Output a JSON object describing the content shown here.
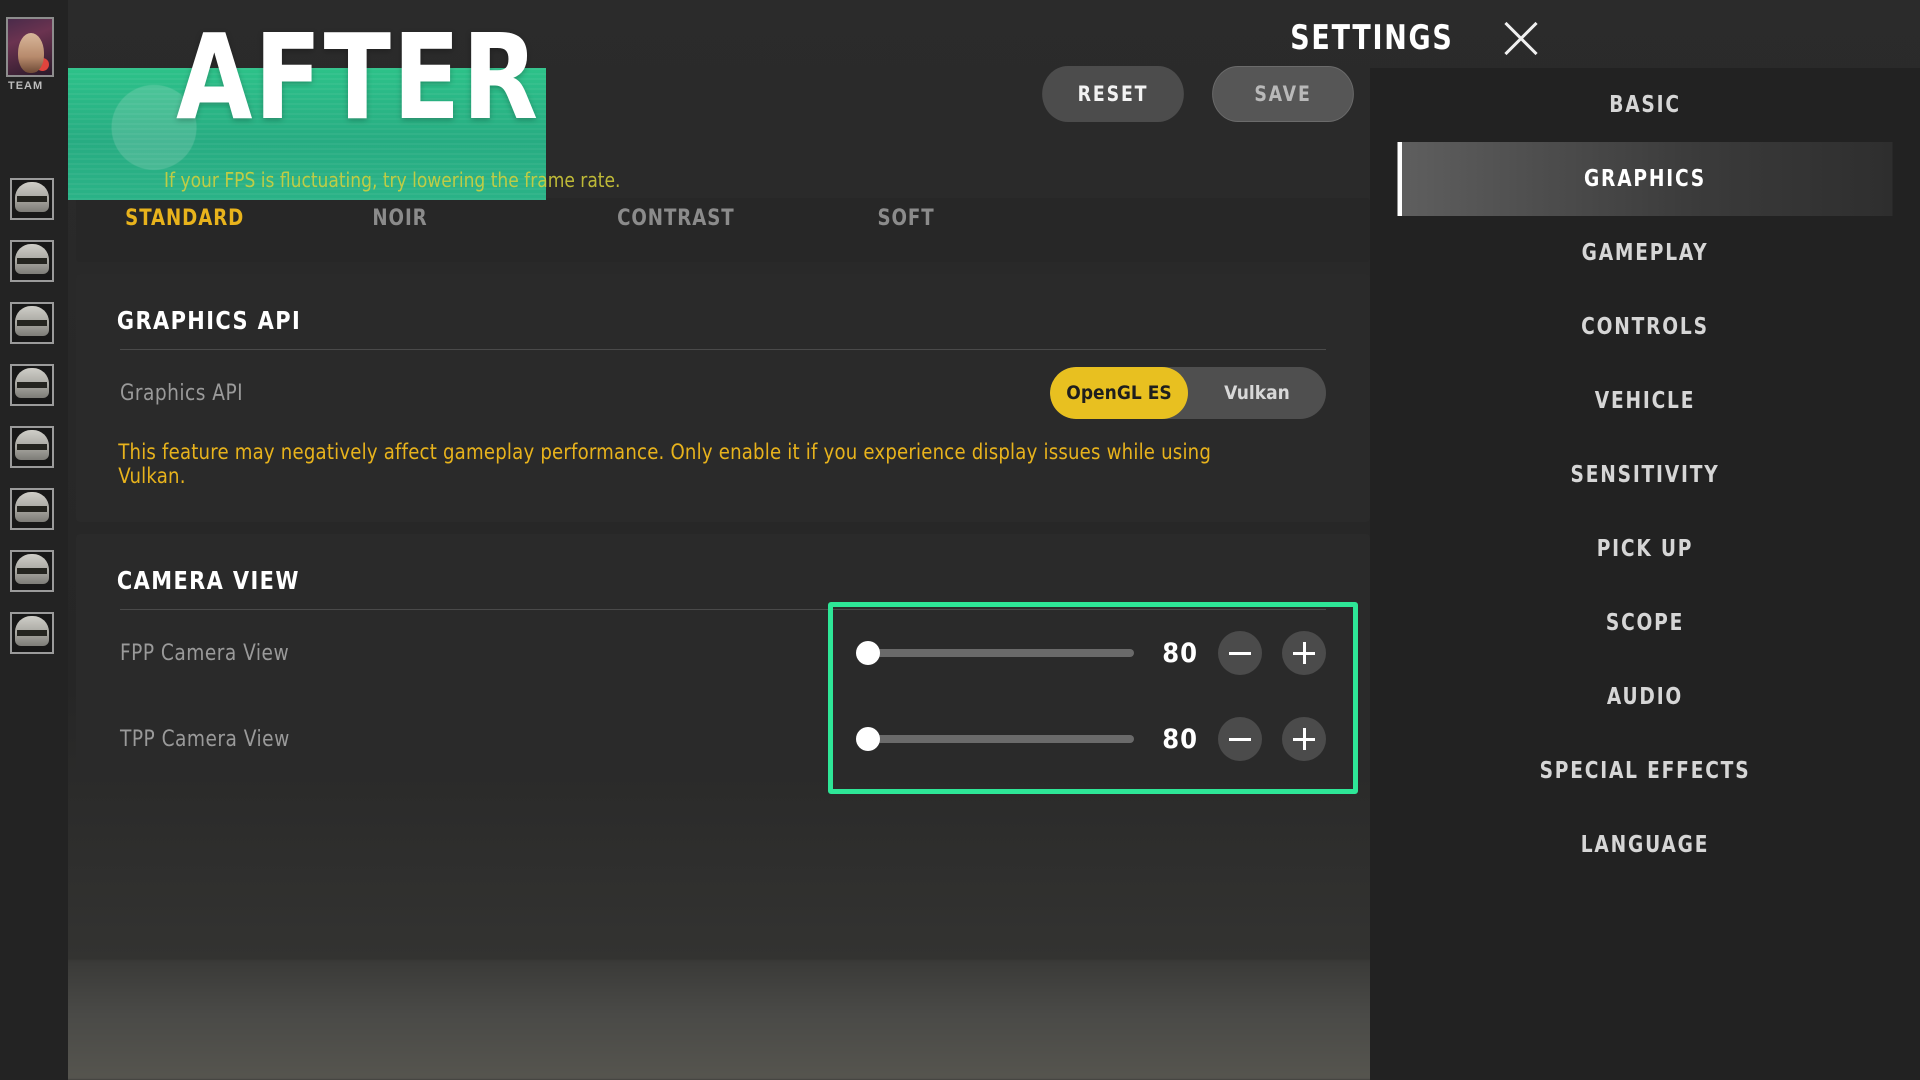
{
  "header": {
    "title": "SETTINGS",
    "close_icon": "close-icon",
    "reset_label": "RESET",
    "save_label": "SAVE"
  },
  "left_rail": {
    "team_label": "TEAM",
    "teammate_count": 8
  },
  "nav": {
    "items": [
      {
        "label": "BASIC",
        "active": false
      },
      {
        "label": "GRAPHICS",
        "active": true
      },
      {
        "label": "GAMEPLAY",
        "active": false
      },
      {
        "label": "CONTROLS",
        "active": false
      },
      {
        "label": "VEHICLE",
        "active": false
      },
      {
        "label": "SENSITIVITY",
        "active": false
      },
      {
        "label": "PICK UP",
        "active": false
      },
      {
        "label": "SCOPE",
        "active": false
      },
      {
        "label": "AUDIO",
        "active": false
      },
      {
        "label": "SPECIAL EFFECTS",
        "active": false
      },
      {
        "label": "LANGUAGE",
        "active": false
      }
    ]
  },
  "overlay": {
    "banner_text": "AFTER",
    "fps_tip": "If your FPS is fluctuating, try lowering the frame rate.",
    "highlight_color": "#2ee697",
    "banner_color": "#2ecf92"
  },
  "style_section": {
    "options": [
      {
        "label": "STANDARD",
        "selected": true
      },
      {
        "label": "NOIR",
        "selected": false
      },
      {
        "label": "CONTRAST",
        "selected": false
      },
      {
        "label": "SOFT",
        "selected": false
      }
    ]
  },
  "graphics_api": {
    "heading": "GRAPHICS API",
    "row_label": "Graphics API",
    "options": [
      {
        "label": "OpenGL ES",
        "selected": true
      },
      {
        "label": "Vulkan",
        "selected": false
      }
    ],
    "warning": "This feature may negatively affect gameplay performance. Only enable it if you experience display issues while using Vulkan.",
    "warning_color": "#e8b31c",
    "selected_color": "#e8c020"
  },
  "camera_view": {
    "heading": "CAMERA VIEW",
    "rows": [
      {
        "label": "FPP Camera View",
        "value": "80",
        "knob_pct": 0,
        "minus": "minus-icon",
        "plus": "plus-icon"
      },
      {
        "label": "TPP Camera View",
        "value": "80",
        "knob_pct": 0,
        "minus": "minus-icon",
        "plus": "plus-icon"
      }
    ]
  }
}
